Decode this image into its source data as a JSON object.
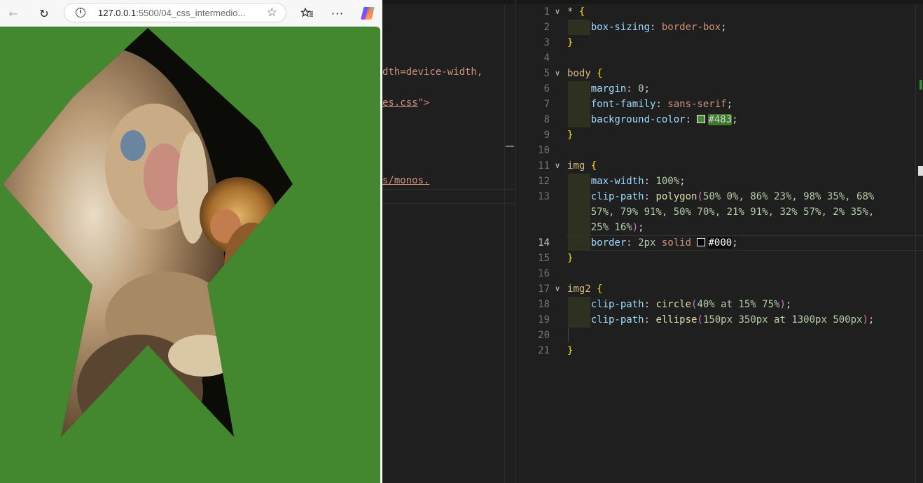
{
  "browser": {
    "url_host": "127.0.0.1",
    "url_rest": ":5500/04_css_intermedio...",
    "page_background": "#43882f",
    "image_alt": "Monkeys"
  },
  "left_editor": {
    "fragments": [
      {
        "text": "dth=device-width,",
        "kind": "attr"
      },
      {
        "text": "es.css",
        "kind": "str"
      },
      {
        "text": "\">",
        "kind": "tag"
      },
      {
        "text": "s/monos.",
        "kind": "str"
      }
    ]
  },
  "code": {
    "line_numbers": [
      "1",
      "2",
      "3",
      "4",
      "5",
      "6",
      "7",
      "8",
      "9",
      "10",
      "11",
      "12",
      "13",
      "",
      "",
      "14",
      "15",
      "16",
      "17",
      "18",
      "19",
      "20",
      "21"
    ],
    "l1_sel": "*",
    "l1_brace": "{",
    "l2_prop": "box-sizing",
    "l2_val": "border-box",
    "l3_brace": "}",
    "l5_sel": "body",
    "l5_brace": "{",
    "l6_prop": "margin",
    "l6_val": "0",
    "l7_prop": "font-family",
    "l7_val": "sans-serif",
    "l8_prop": "background-color",
    "l8_val": "#483",
    "l9_brace": "}",
    "l11_sel": "img",
    "l11_brace": "{",
    "l12_prop": "max-width",
    "l12_val": "100%",
    "l13_prop": "clip-path",
    "l13_fn": "polygon",
    "l13_a": "50% 0%, 86% 23%, 98% 35%, 68%",
    "l13_b": "57%, 79% 91%, 50% 70%, 21% 91%, 32% 57%, 2% 35%,",
    "l13_c": "25% 16%",
    "l14_prop": "border",
    "l14_val1": "2px",
    "l14_val2": "solid",
    "l14_val3": "#000",
    "l15_brace": "}",
    "l17_sel": "img2",
    "l17_brace": "{",
    "l18_prop": "clip-path",
    "l18_fn": "circle",
    "l18_args": "40% at 15% 75%",
    "l19_prop": "clip-path",
    "l19_fn": "ellipse",
    "l19_args": "150px 350px at 1300px 500px",
    "l21_brace": "}"
  },
  "colors": {
    "swatch_green": "#448833",
    "swatch_black": "#000000"
  }
}
